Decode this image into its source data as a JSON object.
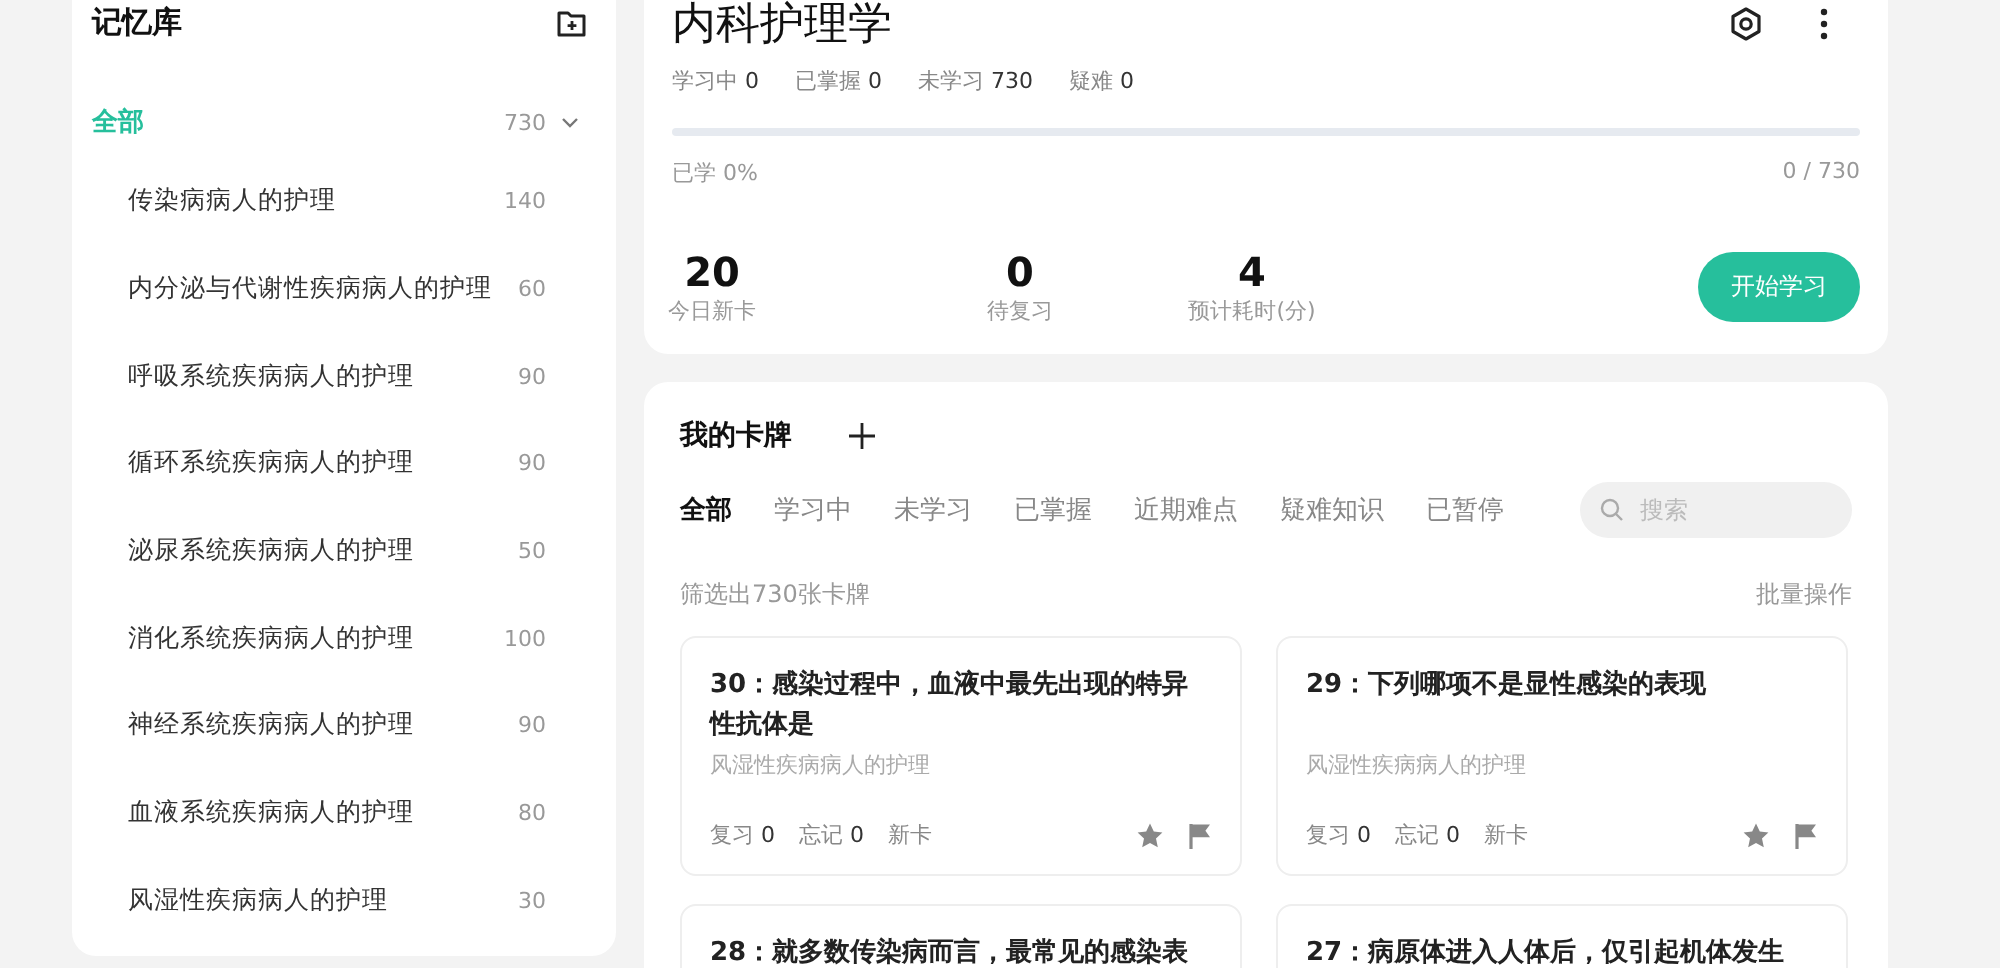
{
  "sidebar": {
    "title": "记忆库",
    "root": {
      "label": "全部",
      "count": "730",
      "expanded": true,
      "selected": true,
      "children": [
        {
          "label": "传染病病人的护理",
          "count": "140",
          "selected": false
        },
        {
          "label": "内分泌与代谢性疾病病人的护理",
          "count": "60",
          "selected": false
        },
        {
          "label": "呼吸系统疾病病人的护理",
          "count": "90",
          "selected": false
        },
        {
          "label": "循环系统疾病病人的护理",
          "count": "90",
          "selected": false
        },
        {
          "label": "泌尿系统疾病病人的护理",
          "count": "50",
          "selected": false
        },
        {
          "label": "消化系统疾病病人的护理",
          "count": "100",
          "selected": false
        },
        {
          "label": "神经系统疾病病人的护理",
          "count": "90",
          "selected": false
        },
        {
          "label": "血液系统疾病病人的护理",
          "count": "80",
          "selected": false
        },
        {
          "label": "风湿性疾病病人的护理",
          "count": "30",
          "selected": false
        }
      ]
    }
  },
  "deck": {
    "title": "内科护理学",
    "stats": [
      {
        "label": "学习中",
        "value": "0"
      },
      {
        "label": "已掌握",
        "value": "0"
      },
      {
        "label": "未学习",
        "value": "730"
      },
      {
        "label": "疑难",
        "value": "0"
      }
    ],
    "progress": {
      "level": 0,
      "label": "已学 0%",
      "reading": "0 / 730"
    },
    "summary": [
      {
        "value": "20",
        "label": "今日新卡"
      },
      {
        "value": "0",
        "label": "待复习"
      },
      {
        "value": "4",
        "label": "预计耗时(分)"
      }
    ],
    "start_button": "开始学习"
  },
  "cards_panel": {
    "title": "我的卡牌",
    "tabs": [
      {
        "label": "全部",
        "selected": true
      },
      {
        "label": "学习中",
        "selected": false
      },
      {
        "label": "未学习",
        "selected": false
      },
      {
        "label": "已掌握",
        "selected": false
      },
      {
        "label": "近期难点",
        "selected": false
      },
      {
        "label": "疑难知识",
        "selected": false
      },
      {
        "label": "已暂停",
        "selected": false
      }
    ],
    "search": {
      "placeholder": "搜索"
    },
    "count_text": "筛选出730张卡牌",
    "batch_action": "批量操作",
    "cards": [
      {
        "title": "30：感染过程中，血液中最先出现的特异性抗体是",
        "category": "风湿性疾病病人的护理",
        "review": {
          "label": "复习",
          "value": "0"
        },
        "forget": {
          "label": "忘记",
          "value": "0"
        },
        "status": "新卡"
      },
      {
        "title": "29：下列哪项不是显性感染的表现",
        "category": "风湿性疾病病人的护理",
        "review": {
          "label": "复习",
          "value": "0"
        },
        "forget": {
          "label": "忘记",
          "value": "0"
        },
        "status": "新卡"
      },
      {
        "title": "28：就多数传染病而言，最常见的感染表"
      },
      {
        "title": "27：病原体进入人体后，仅引起机体发生"
      }
    ]
  }
}
